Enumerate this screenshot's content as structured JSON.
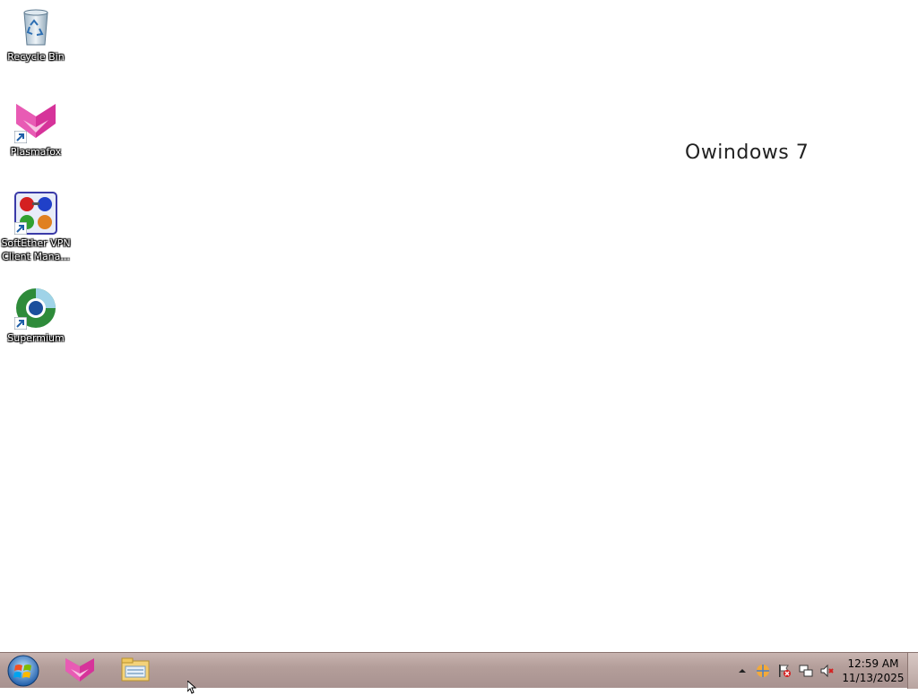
{
  "desktop": {
    "icons": [
      {
        "label": "Recycle Bin",
        "icon": "recycle-bin-icon"
      },
      {
        "label": "Plasmafox",
        "icon": "plasmafox-icon"
      },
      {
        "label": "SoftEther VPN\nClient Mana...",
        "icon": "softether-vpn-icon"
      },
      {
        "label": "Supermium",
        "icon": "supermium-icon"
      }
    ],
    "brand_text": "Owindows 7"
  },
  "taskbar": {
    "start_icon": "windows-start-orb-icon",
    "pinned": [
      {
        "icon": "plasmafox-icon"
      },
      {
        "icon": "file-explorer-icon"
      }
    ],
    "tray": {
      "icons": [
        "show-hidden-icons-chevron",
        "network-globe-icon",
        "action-center-flag-icon",
        "network-icon",
        "volume-muted-icon"
      ]
    },
    "clock": {
      "time": "12:59 AM",
      "date": "11/13/2025"
    }
  },
  "colors": {
    "desktop_bg": "#ffffff",
    "taskbar_bg": "#b49e9a",
    "plasmafox_pink": "#d6339a"
  }
}
